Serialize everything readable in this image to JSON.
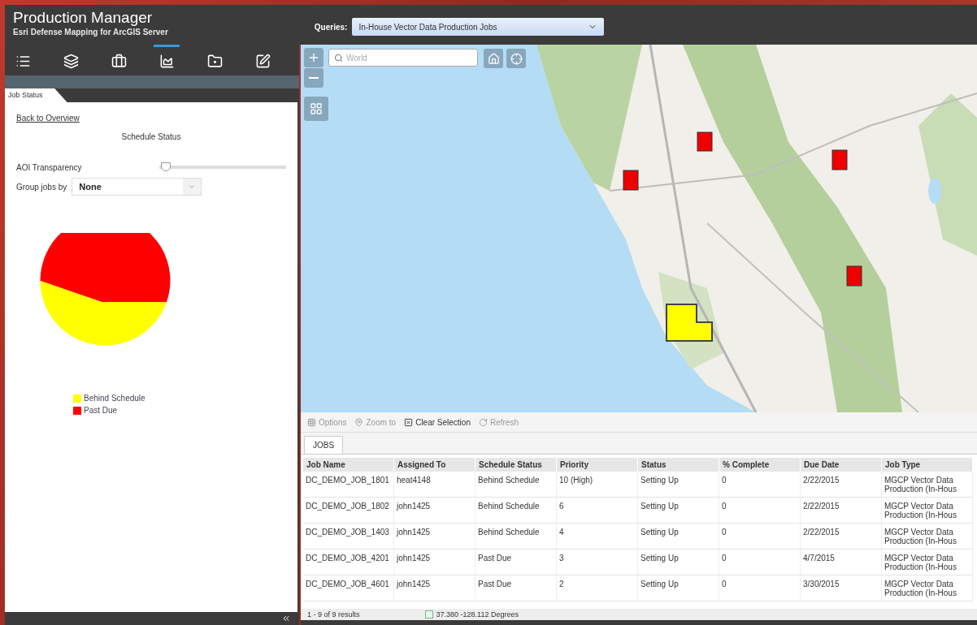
{
  "header": {
    "title": "Production Manager",
    "subtitle": "Esri Defense Mapping for ArcGIS Server",
    "queries_label": "Queries:",
    "query": "In-House Vector Data Production Jobs"
  },
  "sidebar": {
    "toolbar": [
      {
        "kind": "list",
        "selected": false
      },
      {
        "kind": "layers",
        "selected": false
      },
      {
        "kind": "briefcase",
        "selected": false
      },
      {
        "kind": "chart",
        "selected": true
      },
      {
        "kind": "folder",
        "selected": false
      },
      {
        "kind": "notes",
        "selected": false
      }
    ],
    "tab": "Job Status",
    "back_link": "Back to Overview",
    "section_title": "Schedule Status",
    "transparency": {
      "label": "AOI Transparency",
      "level": 0.05
    },
    "group_by": {
      "label": "Group jobs by",
      "value": "None"
    },
    "legend": [
      {
        "label": "Behind Schedule",
        "color": "#ffff00"
      },
      {
        "label": "Past Due",
        "color": "#ff0000"
      }
    ]
  },
  "map": {
    "search": {
      "placeholder": "World"
    }
  },
  "grid_toolbar": [
    {
      "kind": "options",
      "label": "Options",
      "disabled": true
    },
    {
      "kind": "zoom",
      "label": "Zoom to",
      "disabled": true
    },
    {
      "kind": "clear",
      "label": "Clear Selection",
      "disabled": false
    },
    {
      "kind": "refresh",
      "label": "Refresh",
      "disabled": true
    }
  ],
  "table": {
    "tab": "JOBS",
    "columns": [
      "Job Name",
      "Assigned To",
      "Schedule Status",
      "Priority",
      "Status",
      "% Complete",
      "Due Date",
      "Job Type"
    ],
    "rows": [
      [
        "DC_DEMO_JOB_1801",
        "heat4148",
        "Behind Schedule",
        "10 (High)",
        "Setting Up",
        "0",
        "2/22/2015",
        "MGCP Vector Data Production (In-Hous"
      ],
      [
        "DC_DEMO_JOB_1802",
        "john1425",
        "Behind Schedule",
        "6",
        "Setting Up",
        "0",
        "2/22/2015",
        "MGCP Vector Data Production (In-Hous"
      ],
      [
        "DC_DEMO_JOB_1403",
        "john1425",
        "Behind Schedule",
        "4",
        "Setting Up",
        "0",
        "2/22/2015",
        "MGCP Vector Data Production (In-Hous"
      ],
      [
        "DC_DEMO_JOB_4201",
        "john1425",
        "Past Due",
        "3",
        "Setting Up",
        "0",
        "4/7/2015",
        "MGCP Vector Data Production (In-Hous"
      ],
      [
        "DC_DEMO_JOB_4601",
        "john1425",
        "Past Due",
        "2",
        "Setting Up",
        "0",
        "3/30/2015",
        "MGCP Vector Data Production (In-Hous"
      ]
    ]
  },
  "footer": {
    "results": "1 - 9 of 9 results",
    "coordinates": "37.380 -128.112 Degrees"
  }
}
